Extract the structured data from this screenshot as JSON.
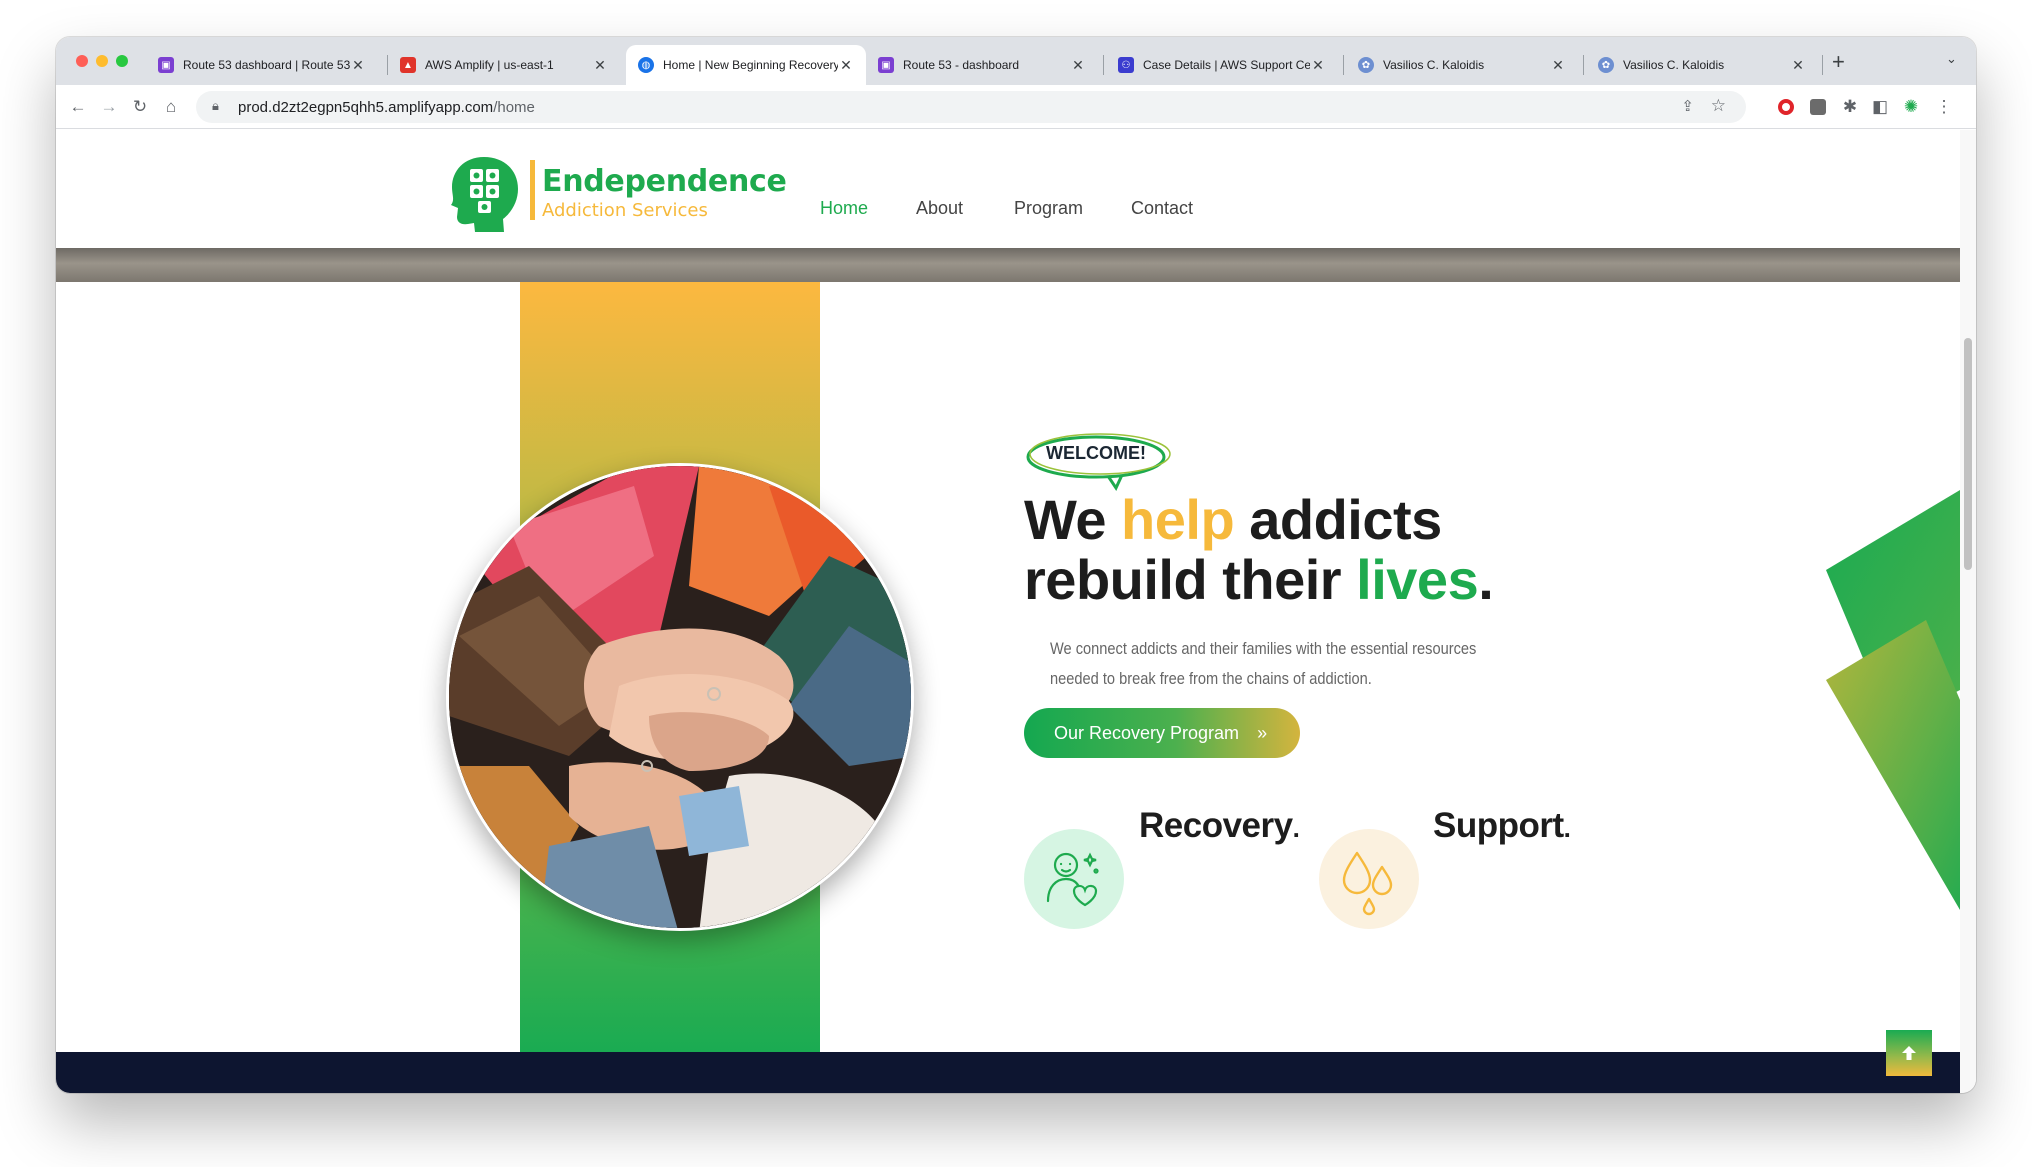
{
  "browser": {
    "tabs": [
      {
        "title": "Route 53 dashboard | Route 53",
        "favicon": "route53-icon",
        "active": false
      },
      {
        "title": "AWS Amplify | us-east-1",
        "favicon": "amplify-icon",
        "active": false
      },
      {
        "title": "Home | New Beginning Recovery",
        "favicon": "globe-icon",
        "active": true
      },
      {
        "title": "Route 53 - dashboard",
        "favicon": "route53-icon",
        "active": false
      },
      {
        "title": "Case Details | AWS Support Center",
        "favicon": "support-icon",
        "active": false
      },
      {
        "title": "Vasilios C. Kaloidis",
        "favicon": "profile-icon",
        "active": false
      },
      {
        "title": "Vasilios C. Kaloidis",
        "favicon": "profile-icon",
        "active": false
      }
    ],
    "url_host": "prod.d2zt2egpn5qhh5.amplifyapp.com",
    "url_path": "/home"
  },
  "site": {
    "logo_title": "Endependence",
    "logo_subtitle": "Addiction Services",
    "nav": [
      {
        "label": "Home",
        "active": true
      },
      {
        "label": "About",
        "active": false
      },
      {
        "label": "Program",
        "active": false
      },
      {
        "label": "Contact",
        "active": false
      }
    ],
    "hero": {
      "badge": "WELCOME!",
      "title_part1": "We ",
      "title_highlight1": "help",
      "title_part2": " addicts",
      "title_part3": "rebuild their ",
      "title_highlight2": "lives",
      "title_part4": ".",
      "description": "We connect addicts and their families with the essential resources needed to break free from the chains of addiction.",
      "cta_label": "Our Recovery Program",
      "cta_icon": "double-chevron-right-icon"
    },
    "features": [
      {
        "label": "Recovery",
        "icon": "mother-child-heart-icon"
      },
      {
        "label": "Support",
        "icon": "water-drops-icon"
      }
    ],
    "feature_dot": "."
  },
  "colors": {
    "brand_green": "#1eaa4e",
    "brand_yellow": "#f6b93b",
    "footer_navy": "#0d1530"
  }
}
